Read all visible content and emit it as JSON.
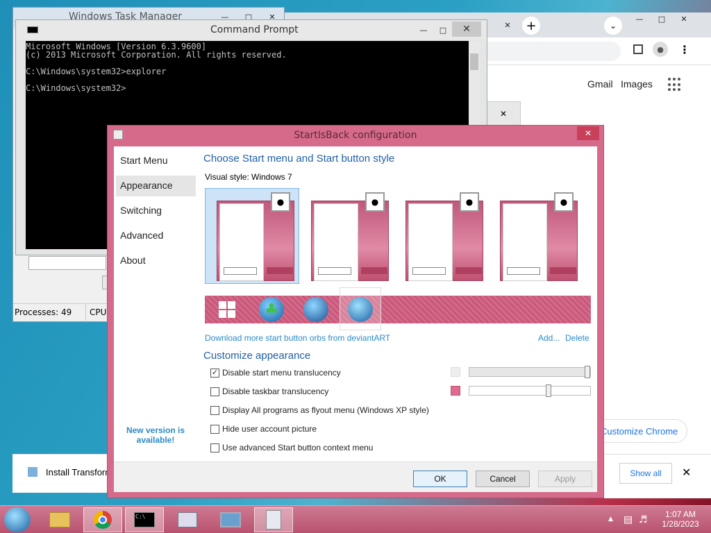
{
  "task_manager": {
    "title": "Windows Task Manager",
    "processes": "Processes: 49",
    "cpu": "CPU"
  },
  "chrome": {
    "gmail": "Gmail",
    "images": "Images",
    "customize": "Customize Chrome",
    "install_label": "Install Transform",
    "show_all": "Show all"
  },
  "cmd": {
    "title": "Command Prompt",
    "lines": "Microsoft Windows [Version 6.3.9600]\n(c) 2013 Microsoft Corporation. All rights reserved.\n\nC:\\Windows\\system32>explorer\n\nC:\\Windows\\system32>"
  },
  "sib": {
    "title": "StartIsBack configuration",
    "nav": [
      "Start Menu",
      "Appearance",
      "Switching",
      "Advanced",
      "About"
    ],
    "heading_style": "Choose Start menu and Start button style",
    "visual_style_label": "Visual style:",
    "visual_style_value": "Windows 7",
    "download_link": "Download more start button orbs from deviantART",
    "add_link": "Add...",
    "delete_link": "Delete",
    "heading_appearance": "Customize appearance",
    "options": [
      {
        "label": "Disable start menu translucency",
        "checked": true
      },
      {
        "label": "Disable taskbar translucency",
        "checked": false
      },
      {
        "label": "Display All programs as flyout menu (Windows XP style)",
        "checked": false
      },
      {
        "label": "Hide user account picture",
        "checked": false
      },
      {
        "label": "Use advanced Start button context menu",
        "checked": false
      }
    ],
    "new_version": "New version is available!",
    "ok": "OK",
    "cancel": "Cancel",
    "apply": "Apply",
    "accent_color": "#d66a8a"
  },
  "taskbar": {
    "time": "1:07 AM",
    "date": "1/28/2023"
  }
}
